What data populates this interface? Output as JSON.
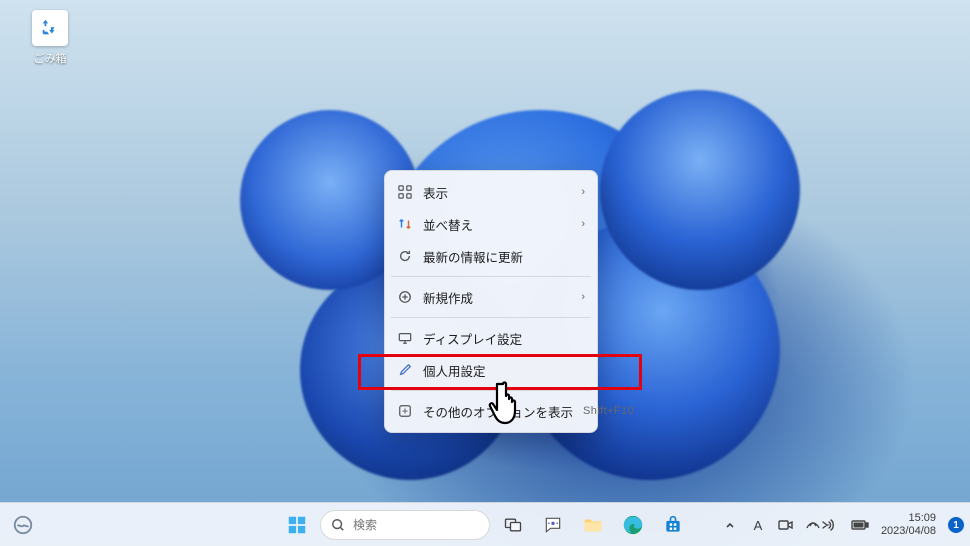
{
  "desktop": {
    "recycle_bin_label": "ごみ箱"
  },
  "context_menu": {
    "items": [
      {
        "label": "表示",
        "icon": "grid-icon",
        "submenu": true
      },
      {
        "label": "並べ替え",
        "icon": "sort-icon",
        "submenu": true
      },
      {
        "label": "最新の情報に更新",
        "icon": "refresh-icon",
        "submenu": false
      },
      {
        "label": "新規作成",
        "icon": "new-icon",
        "submenu": true
      },
      {
        "label": "ディスプレイ設定",
        "icon": "display-icon",
        "submenu": false
      },
      {
        "label": "個人用設定",
        "icon": "personalize-icon",
        "submenu": false,
        "hovered": true
      },
      {
        "label": "その他のオプションを表示",
        "icon": "more-options-icon",
        "submenu": false,
        "shortcut": "Shift+F10"
      }
    ],
    "separators_after_index": [
      2,
      3,
      5
    ]
  },
  "taskbar": {
    "search_placeholder": "検索"
  },
  "tray": {
    "ime_mode": "A",
    "time": "15:09",
    "date": "2023/04/08",
    "notification_count": "1"
  },
  "colors": {
    "highlight": "#e3000f",
    "accent": "#0a63c8"
  }
}
